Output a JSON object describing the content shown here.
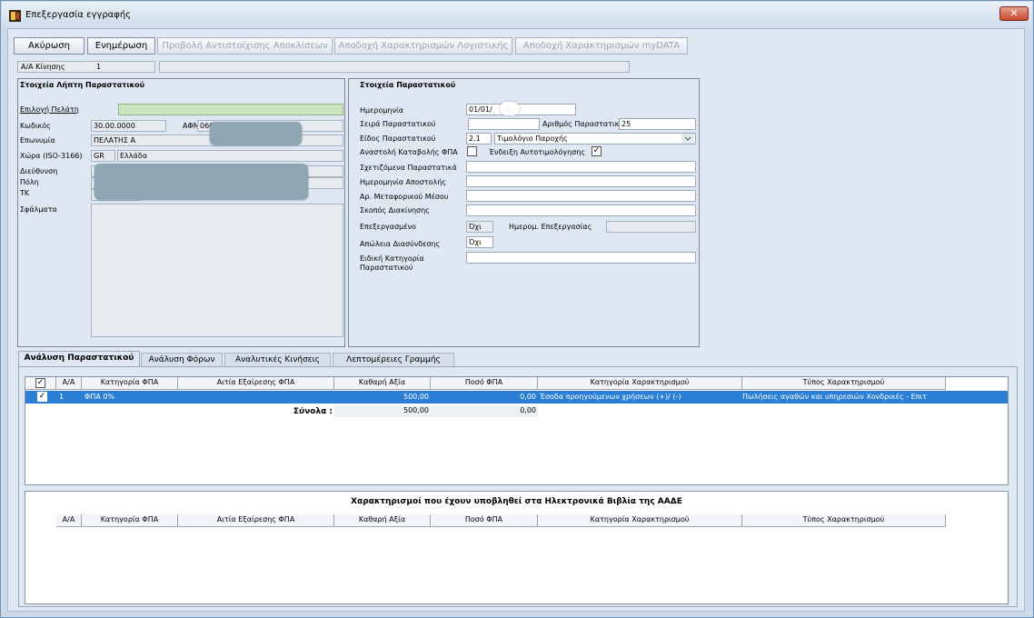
{
  "window": {
    "title": "Επεξεργασία εγγραφής",
    "close_glyph": "✕"
  },
  "toolbar": {
    "cancel": "Ακύρωση",
    "update": "Ενημέρωση",
    "show_deviations": "Προβολή Αντιστοίχισης Αποκλίσεων",
    "accept_accounting": "Αποδοχή Χαρακτηρισμών Λογιστικής",
    "accept_mydata": "Αποδοχή Χαρακτηρισμών myDATA"
  },
  "movement": {
    "label": "Α/Α Κίνησης",
    "value": "1"
  },
  "recipient": {
    "heading": "Στοιχεία Λήπτη Παραστατικού",
    "select_customer": "Επιλογή Πελάτη",
    "code_label": "Κωδικός",
    "code_value": "30.00.0000",
    "afm_label": "ΑΦΜ",
    "afm_value": "066",
    "name_label": "Επωνυμία",
    "name_value": "ΠΕΛΑΤΗΣ Α",
    "country_label": "Χώρα (ISO-3166)",
    "country_code": "GR",
    "country_name": "Ελλάδα",
    "address_label": "Διεύθυνση",
    "city_label": "Πόλη",
    "zip_label": "ΤΚ",
    "errors_label": "Σφάλματα"
  },
  "document": {
    "heading": "Στοιχεία Παραστατικού",
    "date_label": "Ημερομηνία",
    "date_value": "01/01/",
    "series_label": "Σειρά Παραστατικού",
    "series_value": "",
    "number_label": "Αριθμός Παραστατικού",
    "number_value": "25",
    "type_label": "Είδος Παραστατικού",
    "type_code": "2.1",
    "type_name": "Τιμολόγιο Παροχής",
    "vat_suspend_label": "Αναστολή Καταβολής ΦΠΑ",
    "vat_suspend_checked": "",
    "self_billing_label": "Ένδειξη Αυτοτιμολόγησης",
    "self_billing_checked": "✓",
    "related_label": "Σχετιζόμενα Παραστατικά",
    "dispatch_date_label": "Ημερομηνία Αποστολής",
    "vehicle_label": "Αρ. Μεταφορικού Μέσου",
    "purpose_label": "Σκοπός Διακίνησης",
    "processed_label": "Επεξεργασμένο",
    "processed_value": "Όχι",
    "process_date_label": "Ημερομ. Επεξεργασίας",
    "disconnect_label": "Απώλεια Διασύνδεσης",
    "disconnect_value": "Όχι",
    "special_category_label": "Ειδική Κατηγορία Παραστατικού"
  },
  "tabs": [
    "Ανάλυση Παραστατικού",
    "Ανάλυση Φόρων",
    "Αναλυτικές Κινήσεις",
    "Λεπτομέρειες Γραμμής"
  ],
  "table": {
    "headers": [
      "Α/Α",
      "Κατηγορία ΦΠΑ",
      "Αιτία Εξαίρεσης ΦΠΑ",
      "Καθαρή Αξία",
      "Ποσό ΦΠΑ",
      "Κατηγορία Χαρακτηρισμού",
      "Τύπος Χαρακτηρισμού"
    ],
    "header_check": "✓",
    "row": {
      "check": "✓",
      "aa": "1",
      "vat_cat": "ΦΠΑ 0%",
      "exemption": "",
      "net": "500,00",
      "vat": "0,00",
      "char_cat": "Έσοδα προηγούμενων χρήσεων (+)/ (-)",
      "char_type": "Πωλήσεις αγαθών και υπηρεσιών Χονδρικές - Επιτ"
    },
    "totals": {
      "label": "Σύνολα :",
      "net": "500,00",
      "vat": "0,00"
    }
  },
  "submitted": {
    "title": "Χαρακτηρισμοί που έχουν υποβληθεί στα Ηλεκτρονικά Βιβλία της ΑΑΔΕ",
    "headers": [
      "Α/Α",
      "Κατηγορία ΦΠΑ",
      "Αιτία Εξαίρεσης ΦΠΑ",
      "Καθαρή Αξία",
      "Ποσό ΦΠΑ",
      "Κατηγορία Χαρακτηρισμού",
      "Τύπος Χαρακτηρισμού"
    ]
  }
}
